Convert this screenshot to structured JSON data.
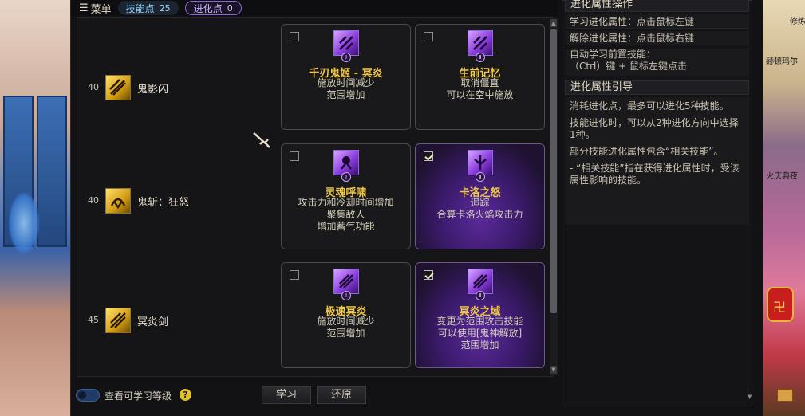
{
  "topbar": {
    "menu_label": "菜单",
    "skill_points_label": "技能点",
    "skill_points_value": "25",
    "evo_points_label": "进化点",
    "evo_points_value": "0"
  },
  "skills": [
    {
      "level": "40",
      "name": "鬼影闪",
      "options": [
        {
          "badge": "Ⅰ",
          "checked": false,
          "title": "千刃鬼姬 - 冥炎",
          "desc": "施放时间减少\n范围增加"
        },
        {
          "badge": "Ⅱ",
          "checked": false,
          "title": "生前记忆",
          "desc": "取消僵直\n可以在空中施放"
        }
      ]
    },
    {
      "level": "40",
      "name": "鬼斩：狂怒",
      "options": [
        {
          "badge": "Ⅰ",
          "checked": false,
          "title": "灵魂呼啸",
          "desc": "攻击力和冷却时间增加\n聚集敌人\n增加蓄气功能"
        },
        {
          "badge": "Ⅱ",
          "checked": true,
          "title": "卡洛之怒",
          "desc": "追踪\n合算卡洛火焰攻击力"
        }
      ]
    },
    {
      "level": "45",
      "name": "冥炎剑",
      "options": [
        {
          "badge": "Ⅰ",
          "checked": false,
          "title": "极速冥炎",
          "desc": "施放时间减少\n范围增加"
        },
        {
          "badge": "Ⅱ",
          "checked": true,
          "title": "冥炎之域",
          "desc": "变更为范围攻击技能\n可以使用[鬼神解放]\n范围增加"
        }
      ]
    }
  ],
  "bottom": {
    "toggle_label": "查看可学习等级",
    "help_icon": "?",
    "learn_button": "学习",
    "reset_button": "还原"
  },
  "panel": {
    "ops_title": "进化属性操作",
    "ops": [
      "学习进化属性：点击鼠标左键",
      "解除进化属性：点击鼠标右键"
    ],
    "auto_line1": "自动学习前置技能：",
    "auto_line2": "（Ctrl）键 + 鼠标左键点击",
    "guide_title": "进化属性引导",
    "guide": [
      "消耗进化点，最多可以进化5种技能。",
      "技能进化时，可以从2种进化方向中选择1种。",
      "部分技能进化属性包含“相关技能”。",
      "- “相关技能”指在获得进化属性时，受该属性影响的技能。"
    ]
  },
  "background_right": {
    "label_top": "修炼",
    "label_name": "赫顿玛尔",
    "label_event": "火庆典夜",
    "lamp_glyph": "卍"
  },
  "colors": {
    "title_gold": "#f0c94a",
    "evo_purple": "#8c6ad8",
    "skill_point_blue": "#8ed0ff"
  }
}
